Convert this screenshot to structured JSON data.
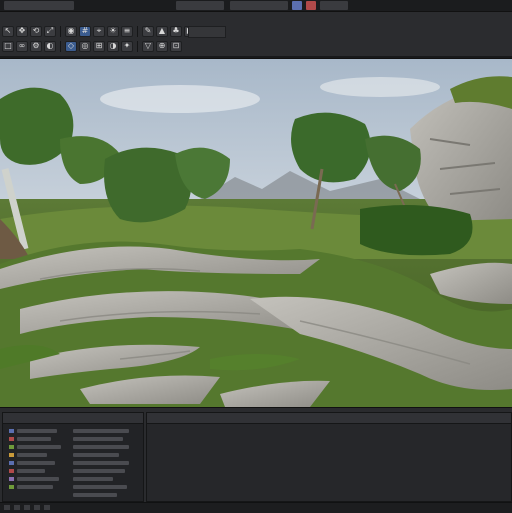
{
  "app": {
    "title": "",
    "status_text": ""
  },
  "toolbar": {
    "buttons": [
      {
        "icon": "select-icon",
        "glyph": "↖"
      },
      {
        "icon": "move-icon",
        "glyph": "✥"
      },
      {
        "icon": "rotate-icon",
        "glyph": "⟲"
      },
      {
        "icon": "scale-icon",
        "glyph": "⤢"
      },
      {
        "icon": "camera-icon",
        "glyph": "◉"
      },
      {
        "icon": "grid-icon",
        "glyph": "#"
      },
      {
        "icon": "snap-icon",
        "glyph": "⌖"
      },
      {
        "icon": "light-icon",
        "glyph": "☀"
      },
      {
        "icon": "layers-icon",
        "glyph": "≡"
      },
      {
        "icon": "brush-icon",
        "glyph": "✎"
      },
      {
        "icon": "terrain-icon",
        "glyph": "▲"
      },
      {
        "icon": "foliage-icon",
        "glyph": "♣"
      },
      {
        "icon": "play-icon",
        "glyph": "▶"
      }
    ],
    "buttons_row2": [
      {
        "icon": "window-icon",
        "glyph": "□"
      },
      {
        "icon": "link-icon",
        "glyph": "∞"
      },
      {
        "icon": "settings-icon",
        "glyph": "⚙"
      },
      {
        "icon": "view-icon",
        "glyph": "◐"
      },
      {
        "icon": "mode-icon",
        "glyph": "◇"
      },
      {
        "icon": "world-icon",
        "glyph": "◎"
      },
      {
        "icon": "wire-icon",
        "glyph": "⊞"
      },
      {
        "icon": "shade-icon",
        "glyph": "◑"
      },
      {
        "icon": "fx-icon",
        "glyph": "✦"
      },
      {
        "icon": "filter-icon",
        "glyph": "▽"
      },
      {
        "icon": "pin-icon",
        "glyph": "⊕"
      },
      {
        "icon": "lock-icon",
        "glyph": "⊡"
      }
    ]
  },
  "colors": {
    "accent": "#3b5c8f",
    "sky_top": "#c9d4df",
    "grass": "#4e7a2a",
    "rock": "#a9a8a2"
  },
  "panels": {
    "left_header": "",
    "right_header": ""
  }
}
